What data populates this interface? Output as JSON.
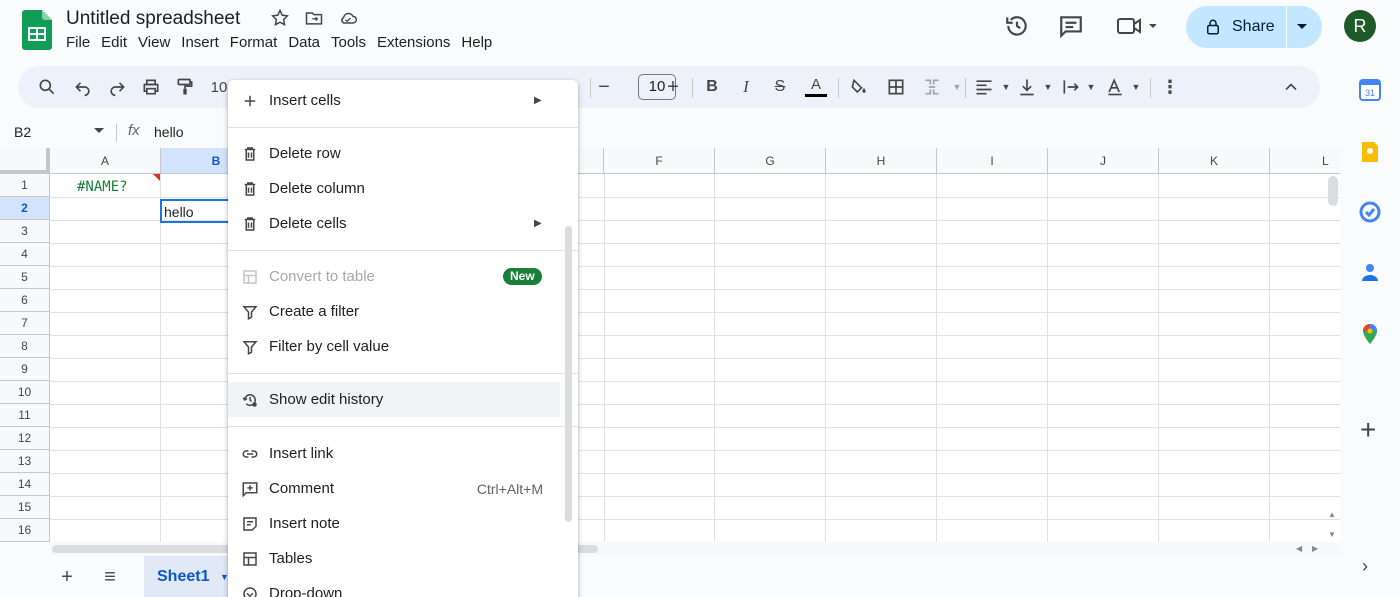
{
  "app": {
    "title": "Untitled spreadsheet",
    "menu": [
      "File",
      "Edit",
      "View",
      "Insert",
      "Format",
      "Data",
      "Tools",
      "Extensions",
      "Help"
    ],
    "share_label": "Share",
    "avatar_initial": "R"
  },
  "toolbar": {
    "zoom_partial": "10",
    "font_size": "10"
  },
  "formula_bar": {
    "name_box": "B2",
    "fx_label": "fx",
    "value": "hello"
  },
  "grid": {
    "columns": [
      "A",
      "B",
      "F",
      "G",
      "H",
      "I",
      "J",
      "K",
      "L"
    ],
    "rows": [
      "1",
      "2",
      "3",
      "4",
      "5",
      "6",
      "7",
      "8",
      "9",
      "10",
      "11",
      "12",
      "13",
      "14",
      "15",
      "16"
    ],
    "cells": {
      "A1": "#NAME?",
      "B2": "hello"
    }
  },
  "sheets": {
    "active_tab": "Sheet1"
  },
  "context_menu": {
    "items": [
      {
        "label": "Insert cells",
        "submenu": true
      },
      {
        "label": "Delete row"
      },
      {
        "label": "Delete column"
      },
      {
        "label": "Delete cells",
        "submenu": true
      },
      {
        "label": "Convert to table",
        "disabled": true,
        "badge": "New"
      },
      {
        "label": "Create a filter"
      },
      {
        "label": "Filter by cell value"
      },
      {
        "label": "Show edit history"
      },
      {
        "label": "Insert link"
      },
      {
        "label": "Comment",
        "shortcut": "Ctrl+Alt+M"
      },
      {
        "label": "Insert note"
      },
      {
        "label": "Tables"
      },
      {
        "label": "Drop-down"
      }
    ]
  },
  "colors": {
    "accent": "#0b57d0",
    "share_bg": "#c2e7ff",
    "badge_green": "#188038",
    "error_red": "#d93025",
    "avatar_bg": "#1e5a2a"
  }
}
